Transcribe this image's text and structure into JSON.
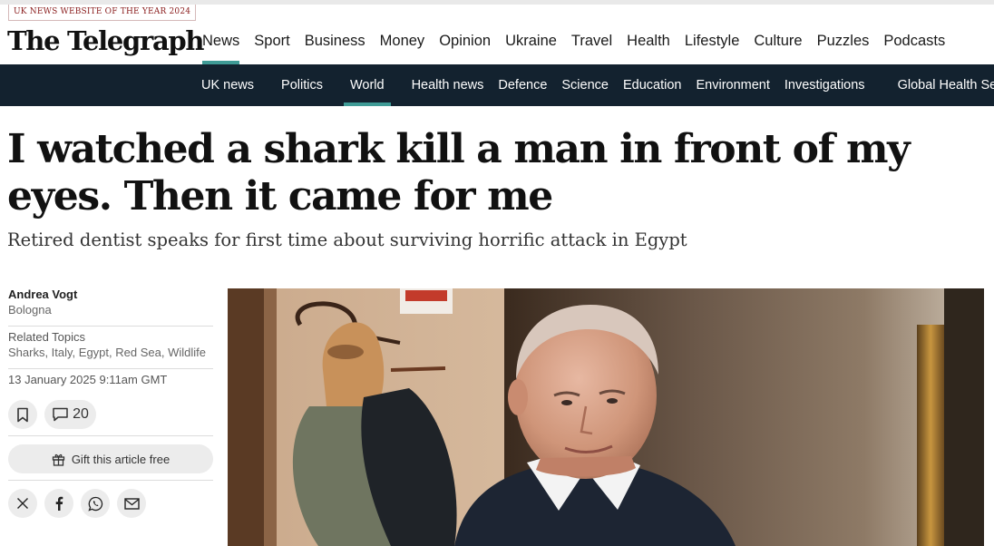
{
  "masthead": {
    "award": "UK NEWS WEBSITE OF THE YEAR 2024",
    "logo": "The Telegraph"
  },
  "primary_nav": [
    "News",
    "Sport",
    "Business",
    "Money",
    "Opinion",
    "Ukraine",
    "Travel",
    "Health",
    "Lifestyle",
    "Culture",
    "Puzzles",
    "Podcasts"
  ],
  "primary_nav_active": "News",
  "sub_nav": [
    "UK news",
    "Politics",
    "World",
    "Health news",
    "Defence",
    "Science",
    "Education",
    "Environment",
    "Investigations",
    "Global Health Sec"
  ],
  "sub_nav_active": "World",
  "article": {
    "headline": "I watched a shark kill a man in front of my eyes. Then it came for me",
    "standfirst": "Retired dentist speaks for first time about surviving horrific attack in Egypt",
    "author": "Andrea Vogt",
    "location": "Bologna",
    "topics_title": "Related Topics",
    "topics": "Sharks, Italy, Egypt, Red Sea, Wildlife",
    "date": "13 January 2025 9:11am GMT",
    "comment_count": "20",
    "gift_label": "Gift this article free"
  },
  "icons": {
    "save": "bookmark-icon",
    "comments": "speech-bubble-icon",
    "gift": "gift-icon",
    "share": [
      "x-icon",
      "facebook-icon",
      "whatsapp-icon",
      "email-icon"
    ]
  },
  "colors": {
    "accent": "#3f9b96",
    "subnav_bg": "#13222f",
    "award_text": "#8a1c1c"
  }
}
